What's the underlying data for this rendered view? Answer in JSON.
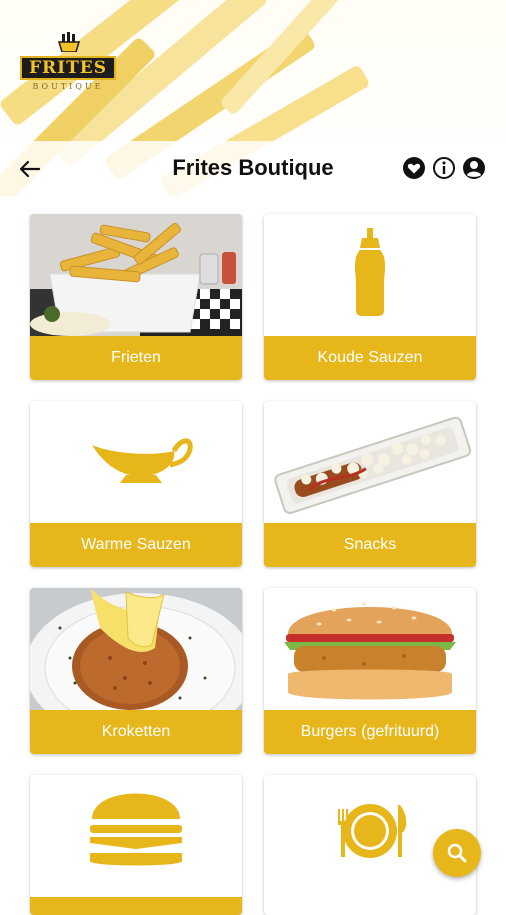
{
  "app": {
    "title": "Frites Boutique",
    "logo_text": "FRITES",
    "logo_subtext": "BOUTIQUE"
  },
  "toolbar": {
    "back_icon": "arrow-left-icon",
    "icons": [
      "heart-icon",
      "info-icon",
      "user-icon"
    ]
  },
  "categories": [
    {
      "label": "Frieten",
      "image": "fries-in-tray-photo"
    },
    {
      "label": "Koude Sauzen",
      "image": "sauce-bottle-icon"
    },
    {
      "label": "Warme Sauzen",
      "image": "gravy-boat-icon"
    },
    {
      "label": "Snacks",
      "image": "snack-tray-photo"
    },
    {
      "label": "Kroketten",
      "image": "croquette-photo"
    },
    {
      "label": "Burgers (gefrituurd)",
      "image": "fried-burger-photo"
    },
    {
      "label": "",
      "image": "burger-icon"
    },
    {
      "label": "",
      "image": "plate-cutlery-icon"
    }
  ],
  "fab": {
    "icon": "search-icon"
  },
  "colors": {
    "accent": "#e7b61b",
    "label_text": "#ffffff",
    "title_text": "#111111"
  }
}
